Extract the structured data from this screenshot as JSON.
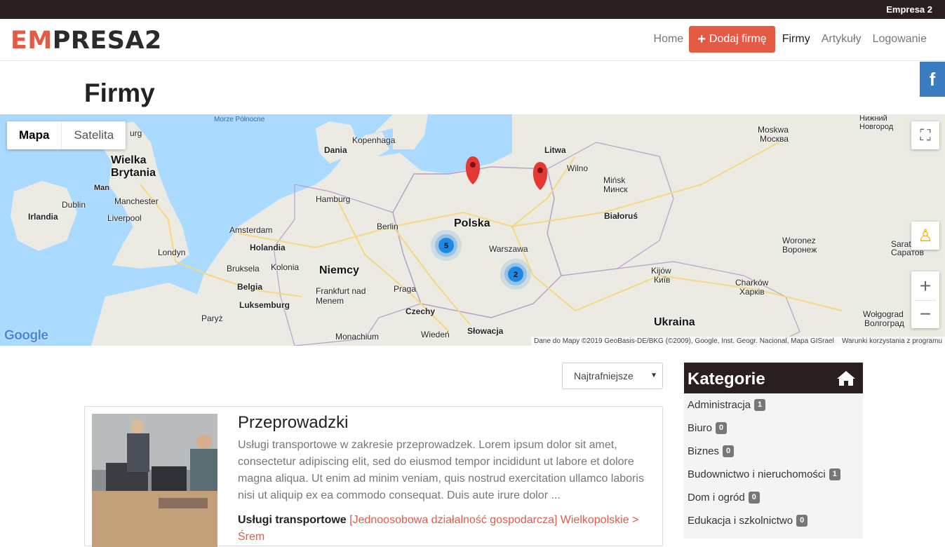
{
  "topbar": {
    "title": "Empresa 2"
  },
  "logo": {
    "part1": "EM",
    "part2": "PRESA2"
  },
  "nav": {
    "home": "Home",
    "add": "Dodaj firmę",
    "companies": "Firmy",
    "articles": "Artykuły",
    "login": "Logowanie"
  },
  "social": {
    "facebook": "f"
  },
  "page": {
    "title": "Firmy"
  },
  "map": {
    "type_map": "Mapa",
    "type_satellite": "Satelita",
    "clusters": [
      "5",
      "2"
    ],
    "google": "Google",
    "attribution": "Dane do Mapy ©2019 GeoBasis-DE/BKG (©2009), Google, Inst. Geogr. Nacional, Mapa GISrael",
    "terms": "Warunki korzystania z programu",
    "labels": {
      "north_sea": "Morze Północne",
      "burg": "urg",
      "dania": "Dania",
      "kopenhaga": "Kopenhaga",
      "litwa": "Litwa",
      "moskwa": "Moskwa",
      "moskwa_ru": "Москва",
      "nizhny": "Нижний Новгород",
      "wielka": "Wielka Brytania",
      "man": "Man",
      "wilno": "Wilno",
      "minsk": "Mińsk",
      "minsk_ru": "Минск",
      "dublin": "Dublin",
      "manchester": "Manchester",
      "irlandia": "Irlandia",
      "liverpool": "Liverpool",
      "hamburg": "Hamburg",
      "bialorus": "Białoruś",
      "polska": "Polska",
      "amsterdam": "Amsterdam",
      "berlin": "Berlin",
      "holandia": "Holandia",
      "londyn": "Londyn",
      "warszawa": "Warszawa",
      "woronez": "Woronez",
      "woronez_ru": "Воронеж",
      "saratow": "Saratow",
      "saratow_ru": "Саратов",
      "niemcy": "Niemcy",
      "bruksela": "Bruksela",
      "kolonia": "Kolonia",
      "kijow": "Kijów",
      "kijow_ru": "Київ",
      "belgia": "Belgia",
      "frankfurt": "Frankfurt nad Menem",
      "praga": "Praga",
      "charkow": "Charków",
      "charkow_ru": "Харків",
      "luksemburg": "Luksemburg",
      "czechy": "Czechy",
      "wolgograd": "Wołgograd",
      "wolgograd_ru": "Волгоград",
      "paryz": "Paryż",
      "slowacja": "Słowacja",
      "ukraina": "Ukraina",
      "monachium": "Monachium",
      "wieden": "Wiedeń"
    }
  },
  "sort": {
    "selected": "Najtrafniejsze"
  },
  "listing": {
    "title": "Przeprowadzki",
    "description": "Usługi transportowe w zakresie przeprowadzek. Lorem ipsum dolor sit amet, consectetur adipiscing elit, sed do eiusmod tempor incididunt ut labore et dolore magna aliqua. Ut enim ad minim veniam, quis nostrud exercitation ullamco laboris nisi ut aliquip ex ea commodo consequat. Duis aute irure dolor ...",
    "category": "Usługi transportowe",
    "meta": "[Jednoosobowa działalność gospodarcza] Wielkopolskie > Śrem"
  },
  "sidebar": {
    "title": "Kategorie",
    "items": [
      {
        "label": "Administracja",
        "count": "1"
      },
      {
        "label": "Biuro",
        "count": "0"
      },
      {
        "label": "Biznes",
        "count": "0"
      },
      {
        "label": "Budownictwo i nieruchomości",
        "count": "1"
      },
      {
        "label": "Dom i ogród",
        "count": "0"
      },
      {
        "label": "Edukacja i szkolnictwo",
        "count": "0"
      }
    ]
  },
  "colors": {
    "accent": "#e35a45",
    "dark": "#2a1f1f",
    "facebook": "#3b7bbf",
    "marker": "#e53935",
    "cluster": "#1e88e5"
  }
}
